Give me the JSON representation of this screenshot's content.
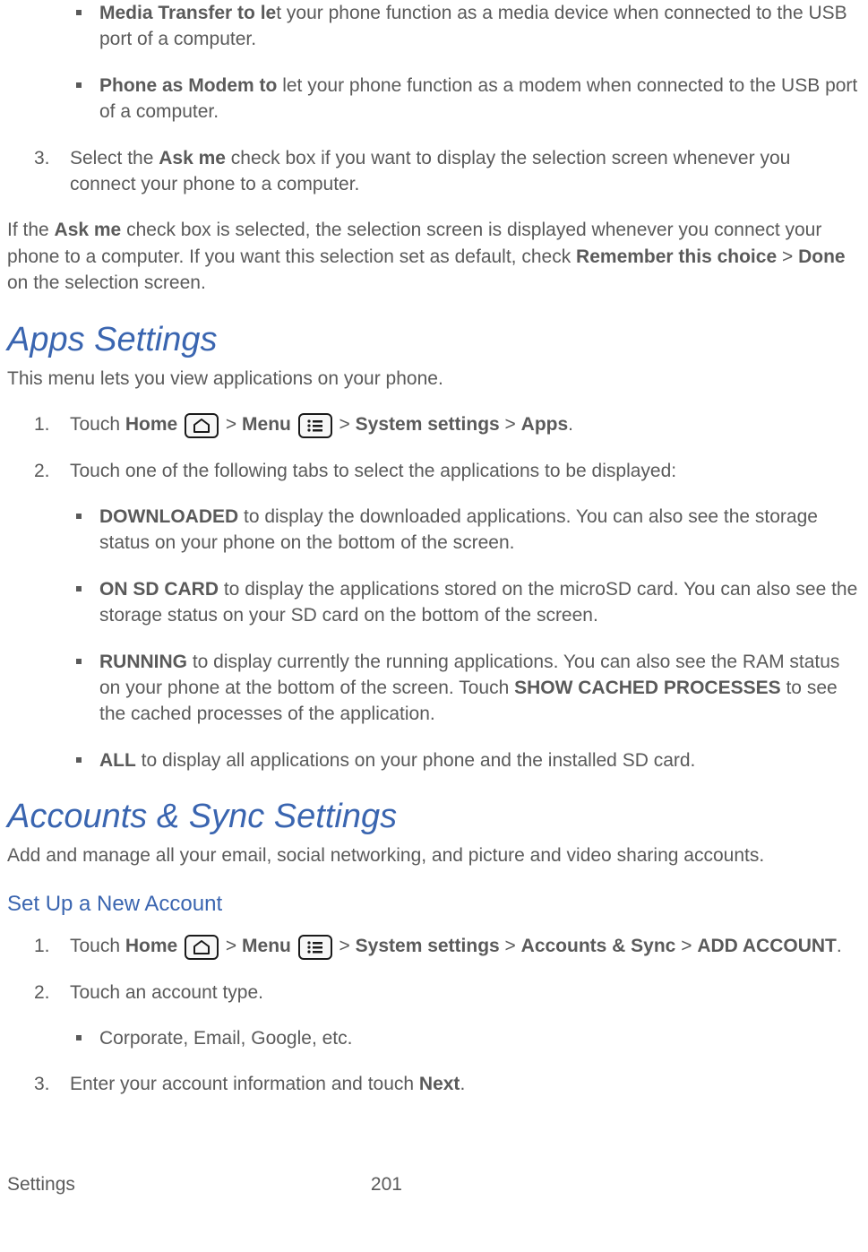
{
  "top": {
    "bullets": [
      {
        "bold": "Media Transfer to le",
        "rest": "t your phone function as a media device when connected to the USB port of a computer."
      },
      {
        "bold": "Phone as Modem to",
        "rest": " let your phone function as a modem when connected to the USB port of a computer."
      }
    ],
    "step3": {
      "num": "3.",
      "before": "Select the ",
      "bold": "Ask me",
      "after": " check box if you want to display the selection screen whenever you connect your phone to a computer."
    },
    "para": {
      "t1": "If the ",
      "b1": "Ask me",
      "t2": " check box is selected, the selection screen is displayed whenever you connect your phone to a computer. If you want this selection set as default, check ",
      "b2": "Remember this choice",
      "t3": " > ",
      "b3": "Done",
      "t4": " on the selection screen."
    }
  },
  "apps": {
    "heading": "Apps Settings",
    "intro": "This menu lets you view applications on your phone.",
    "step1": {
      "num": "1.",
      "touch": "Touch ",
      "home": "Home",
      "gt1": " > ",
      "menu": "Menu",
      "gt2": " > ",
      "sys": "System settings",
      "gt3": " > ",
      "apps": "Apps",
      "dot": "."
    },
    "step2": {
      "num": "2.",
      "text": "Touch one of the following tabs to select the applications to be displayed:"
    },
    "tabs": [
      {
        "bold": "DOWNLOADED",
        "rest": " to display the downloaded applications. You can also see the storage status on your phone on the bottom of the screen."
      },
      {
        "bold": "ON SD CARD",
        "rest": " to display the applications stored on the microSD card. You can also see the storage status on your SD card on the bottom of the screen."
      }
    ],
    "running": {
      "bold": "RUNNING",
      "t1": " to display currently the running applications. You can also see the RAM status on your phone at the bottom of the screen. Touch ",
      "b2": "SHOW CACHED PROCESSES",
      "t2": " to see the cached processes of the application."
    },
    "all": {
      "bold": "ALL",
      "rest": " to display all applications on your phone and the installed SD card."
    }
  },
  "accounts": {
    "heading": "Accounts & Sync Settings",
    "intro": "Add and manage all your email, social networking, and picture and video sharing accounts.",
    "sub": "Set Up a New Account",
    "step1": {
      "num": "1.",
      "touch": "Touch ",
      "home": "Home",
      "gt1": " > ",
      "menu": "Menu",
      "gt2": " > ",
      "sys": "System settings",
      "gt3": " > ",
      "acc": "Accounts & Sync",
      "gt4": " > ",
      "add": "ADD ACCOUNT",
      "dot": "."
    },
    "step2": {
      "num": "2.",
      "text": "Touch an account type."
    },
    "sub_bullet": "Corporate, Email, Google, etc.",
    "step3": {
      "num": "3.",
      "t1": "Enter your account information and touch ",
      "b1": "Next",
      "t2": "."
    }
  },
  "footer": {
    "section": "Settings",
    "page": "201"
  }
}
